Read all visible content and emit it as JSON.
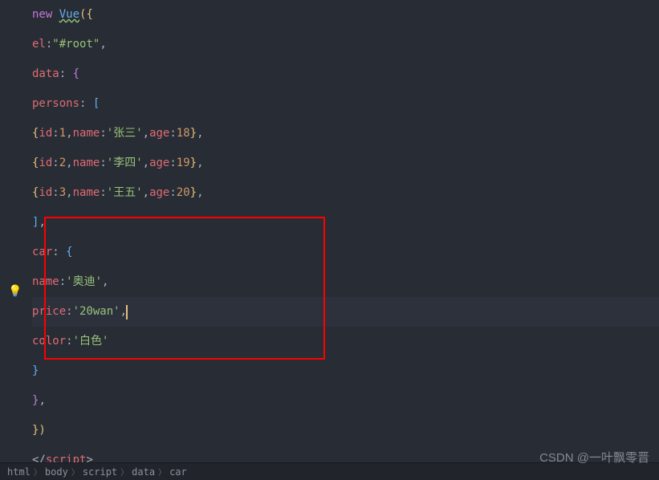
{
  "code": {
    "line1_new": "new ",
    "line1_vue": "Vue",
    "line2_el": "el",
    "line2_val": "\"#root\"",
    "line3_data": "data",
    "line4_persons": "persons",
    "person_id": "id",
    "person_name": "name",
    "person_age": "age",
    "p1_id": "1",
    "p1_name": "'张三'",
    "p1_age": "18",
    "p2_id": "2",
    "p2_name": "'李四'",
    "p2_age": "19",
    "p3_id": "3",
    "p3_name": "'王五'",
    "p3_age": "20",
    "car": "car",
    "car_name_k": "name",
    "car_name_v": "'奥迪'",
    "car_price_k": "price",
    "car_price_v": "'20wan'",
    "car_color_k": "color",
    "car_color_v": "'白色'",
    "script_close": "script"
  },
  "breadcrumb": {
    "b1": "html",
    "b2": "body",
    "b3": "script",
    "b4": "data",
    "b5": "car"
  },
  "watermark": "CSDN @一叶飘零晋"
}
